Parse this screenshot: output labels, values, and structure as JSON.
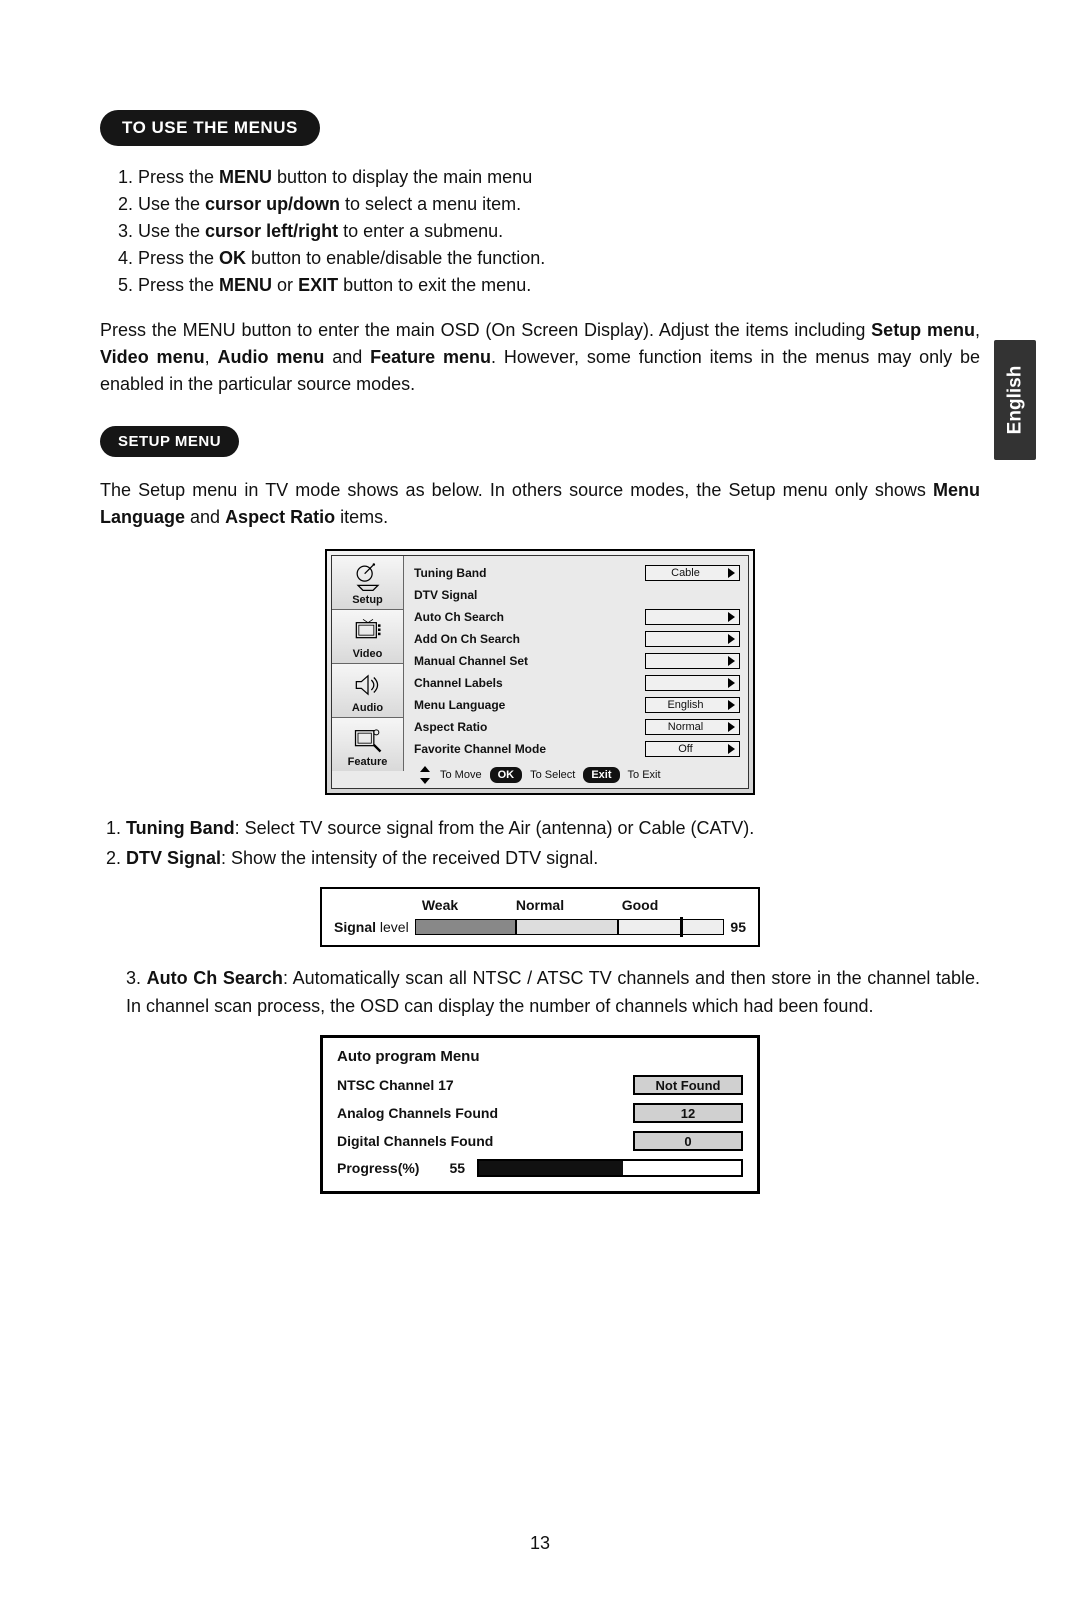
{
  "langtab": "English",
  "heading1": "TO USE THE MENUS",
  "steps": [
    {
      "pre": "Press the ",
      "bold": "MENU",
      "post": " button to display the main menu"
    },
    {
      "pre": "Use the ",
      "bold": "cursor up/down",
      "post": " to select a menu item."
    },
    {
      "pre": "Use the ",
      "bold": "cursor left/right",
      "post": " to enter a submenu."
    },
    {
      "pre": "Press the ",
      "bold": "OK",
      "post": " button to enable/disable the function."
    },
    {
      "pre": "Press the ",
      "bold": "MENU",
      "post": " or ",
      "bold2": "EXIT",
      "post2": " button to exit the menu."
    }
  ],
  "para1": {
    "t1": "Press the MENU button to enter the main OSD (On Screen Display). Adjust the items including ",
    "b1": "Setup menu",
    "c1": ", ",
    "b2": "Video menu",
    "c2": ", ",
    "b3": "Audio menu",
    "c3": " and ",
    "b4": "Feature menu",
    "c4": ". However, some function items in the menus may only be enabled in the particular source modes."
  },
  "heading2": "SETUP MENU",
  "para2": {
    "t1": "The Setup menu in TV mode shows as below. In others source modes, the Setup menu only shows ",
    "b1": "Menu Language",
    "c1": " and ",
    "b2": "Aspect Ratio",
    "c2": " items."
  },
  "osd": {
    "tabs": [
      "Setup",
      "Video",
      "Audio",
      "Feature"
    ],
    "rows": [
      {
        "label": "Tuning Band",
        "value": "Cable"
      },
      {
        "label": "DTV Signal",
        "value": ""
      },
      {
        "label": "Auto Ch Search",
        "value": "_arrow"
      },
      {
        "label": "Add On Ch Search",
        "value": "_arrow"
      },
      {
        "label": "Manual Channel Set",
        "value": "_arrow"
      },
      {
        "label": "Channel Labels",
        "value": "_arrow"
      },
      {
        "label": "Menu Language",
        "value": "English"
      },
      {
        "label": "Aspect Ratio",
        "value": "Normal"
      },
      {
        "label": "Favorite Channel Mode",
        "value": "Off"
      }
    ],
    "actions": {
      "move": "To Move",
      "ok": "OK",
      "select": "To Select",
      "exit": "Exit",
      "toexit": "To Exit"
    }
  },
  "desc": [
    {
      "bold": "Tuning Band",
      "text": ": Select TV source signal from the Air (antenna) or Cable (CATV)."
    },
    {
      "bold": "DTV Signal",
      "text": ": Show the intensity of the received DTV signal."
    }
  ],
  "signal": {
    "heads": [
      "Weak",
      "Normal",
      "Good"
    ],
    "label_bold": "Signal",
    "label_rest": " level",
    "value": "95",
    "marker_percent": 86
  },
  "desc3": {
    "num": "3.",
    "bold": "Auto Ch Search",
    "text": ": Automatically scan all NTSC / ATSC TV channels and then store in the channel table. In channel scan process, the OSD can display the number of channels which had been found."
  },
  "ap": {
    "title": "Auto program Menu",
    "rows": [
      {
        "label": "NTSC Channel 17",
        "value": "Not Found"
      },
      {
        "label": "Analog Channels Found",
        "value": "12"
      },
      {
        "label": "Digital Channels Found",
        "value": "0"
      }
    ],
    "progress_label": "Progress(%)",
    "progress_value": "55",
    "progress_percent": 55
  },
  "page_number": "13"
}
